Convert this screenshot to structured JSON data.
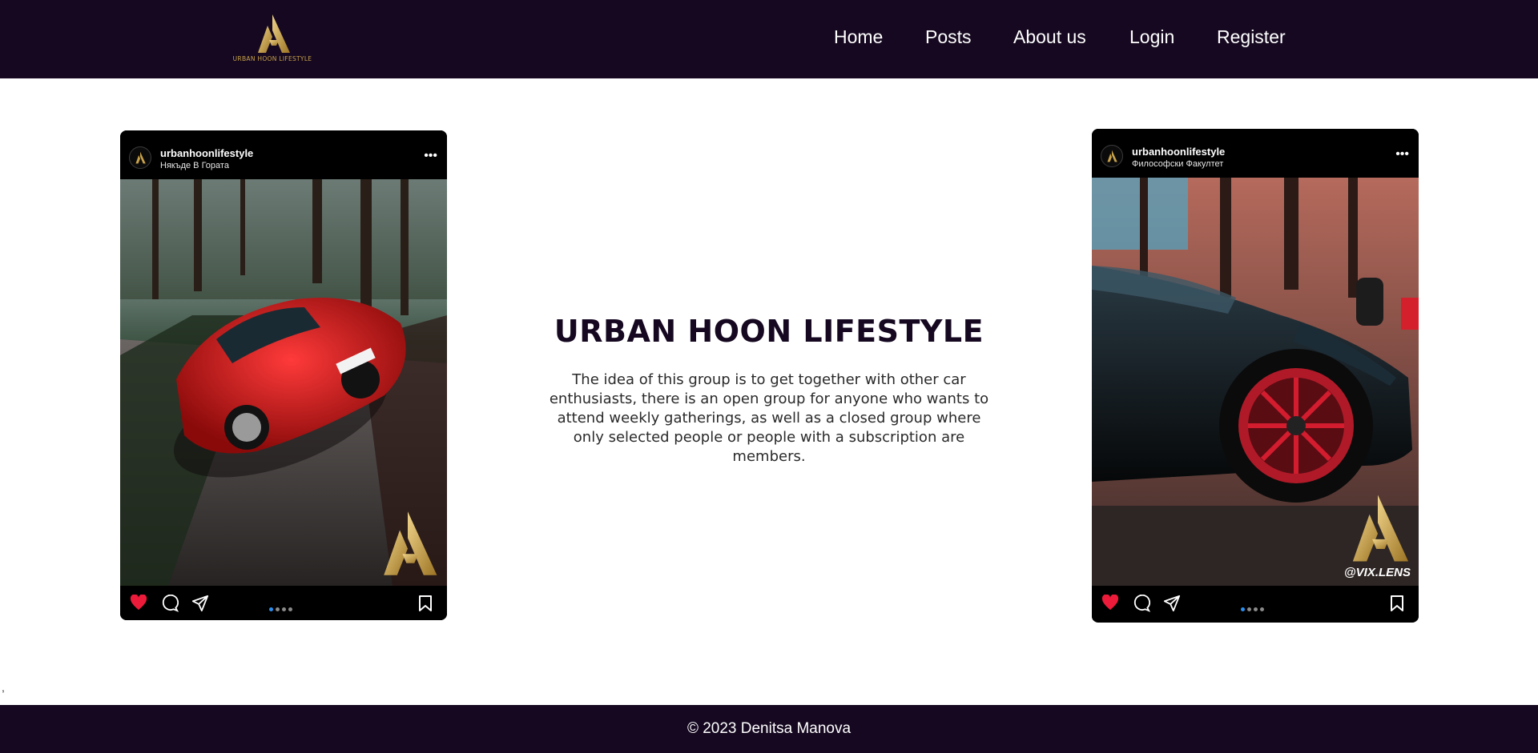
{
  "header": {
    "logo_text": "URBAN HOON LIFESTYLE",
    "nav": [
      {
        "label": "Home"
      },
      {
        "label": "Posts"
      },
      {
        "label": "About us"
      },
      {
        "label": "Login"
      },
      {
        "label": "Register"
      }
    ]
  },
  "posts": [
    {
      "username": "urbanhoonlifestyle",
      "location": "Някъде В Гората",
      "liked": true,
      "carousel_dots": 4,
      "active_dot": 1
    },
    {
      "username": "urbanhoonlifestyle",
      "location": "Философски Факултет",
      "watermark": "@VIX.LENS",
      "liked": true,
      "carousel_dots": 4,
      "active_dot": 1
    }
  ],
  "main": {
    "title": "URBAN HOON LIFESTYLE",
    "description": "The idea of this group is to get together with other car enthusiasts, there is an open group for anyone who wants to attend weekly gatherings, as well as a closed group where only selected people or people with a subscription are members."
  },
  "stray_text": ",",
  "footer": {
    "copyright": "© 2023 Denitsa Manova"
  },
  "colors": {
    "navy": "#150820",
    "gold": "#c9a24a",
    "like_red": "#ed1b3a",
    "dot_active": "#2b8ff0"
  },
  "icons": [
    "heart-icon",
    "comment-icon",
    "share-icon",
    "bookmark-icon",
    "more-icon"
  ]
}
